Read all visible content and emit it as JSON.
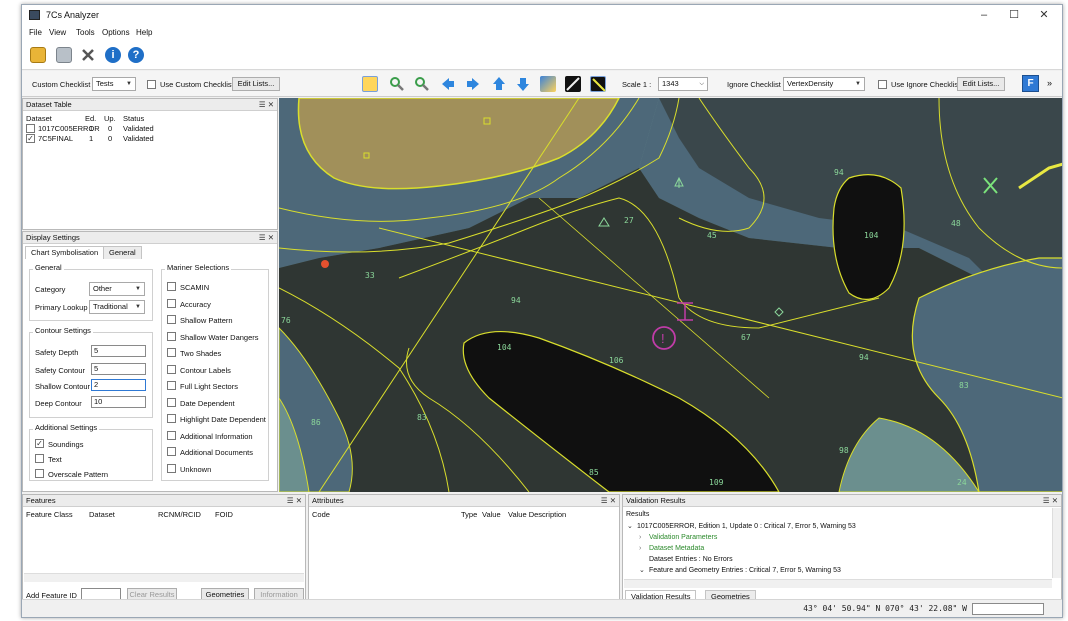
{
  "window": {
    "title": "7Cs Analyzer",
    "minimize": "–",
    "maximize": "☐",
    "close": "✕"
  },
  "menu": [
    "File",
    "View",
    "Tools",
    "Options",
    "Help"
  ],
  "toolbar": {
    "custom_checklist_label": "Custom Checklist",
    "custom_checklist_value": "Tests",
    "use_custom_checklist": "Use Custom Checklist",
    "edit_lists": "Edit Lists...",
    "scale_label": "Scale 1 :",
    "scale_value": "1343",
    "ignore_checklist_label": "Ignore Checklist",
    "ignore_checklist_value": "VertexDensity",
    "use_ignore_checklist": "Use Ignore Checklist",
    "edit_lists_2": "Edit Lists...",
    "f_button": "F",
    "overflow": "»"
  },
  "dataset_table": {
    "title": "Dataset Table",
    "ctl": "☰ ✕",
    "columns": [
      "Dataset",
      "Ed.",
      "Up.",
      "Status"
    ],
    "rows": [
      {
        "check": "",
        "name": "1017C005ERROR",
        "ed": "1",
        "up": "0",
        "status": "Validated"
      },
      {
        "check": "✓",
        "name": "7C5FINAL",
        "ed": "1",
        "up": "0",
        "status": "Validated"
      }
    ]
  },
  "display_settings": {
    "title": "Display Settings",
    "ctl": "☰ ✕",
    "tabs": [
      "Chart Symbolisation",
      "General"
    ],
    "general_group": "General",
    "category_label": "Category",
    "category_value": "Other",
    "primary_lookup_label": "Primary Lookup",
    "primary_lookup_value": "Traditional",
    "contour_group": "Contour Settings",
    "safety_depth_label": "Safety Depth",
    "safety_depth_value": "5",
    "safety_contour_label": "Safety Contour",
    "safety_contour_value": "5",
    "shallow_contour_label": "Shallow Contour",
    "shallow_contour_value": "2",
    "deep_contour_label": "Deep Contour",
    "deep_contour_value": "10",
    "additional_group": "Additional Settings",
    "soundings": "Soundings",
    "text": "Text",
    "overscale": "Overscale Pattern",
    "mariner_group": "Mariner Selections",
    "mariner": [
      "SCAMIN",
      "Accuracy",
      "Shallow Pattern",
      "Shallow Water Dangers",
      "Two Shades",
      "Contour Labels",
      "Full Light Sectors",
      "Date Dependent",
      "Highlight Date Dependent",
      "Additional Information",
      "Additional Documents",
      "Unknown"
    ]
  },
  "features": {
    "title": "Features",
    "ctl": "☰ ✕",
    "columns": [
      "Feature Class",
      "Dataset",
      "RCNM/RCID",
      "FOID"
    ],
    "add_feature_label": "Add Feature ID",
    "clear_results": "Clear Results",
    "geometries": "Geometries",
    "information": "Information"
  },
  "attributes": {
    "title": "Attributes",
    "ctl": "☰ ✕",
    "columns": [
      "Code",
      "Type",
      "Value",
      "Value Description"
    ]
  },
  "validation": {
    "title": "Validation Results",
    "ctl": "☰ ✕",
    "results_header": "Results",
    "line1": "1017C005ERROR, Edition 1, Update 0 : Critical 7, Error 5, Warning 53",
    "line2": "Validation Parameters",
    "line3": "Dataset Metadata",
    "line4": "Dataset Entries : No Errors",
    "line5": "Feature and Geometry Entries : Critical 7, Error 5, Warning 53",
    "tabs": [
      "Validation Results",
      "Geometries"
    ]
  },
  "status": {
    "coordinates": "43° 04' 50.94\" N  070° 43' 22.08\" W"
  },
  "map": {
    "soundings": [
      "94",
      "27",
      "45",
      "104",
      "48",
      "33",
      "94",
      "104",
      "106",
      "67",
      "94",
      "83",
      "98",
      "83",
      "86",
      "85",
      "109",
      "24",
      "76"
    ]
  },
  "colors": {
    "land": "#a1905a",
    "deep": "#101010",
    "medium": "#4d6879",
    "shallow": "#6b8f8e",
    "dark_water": "#2f3633",
    "contour": "#d9de2c",
    "accent": "#c03ca8"
  }
}
